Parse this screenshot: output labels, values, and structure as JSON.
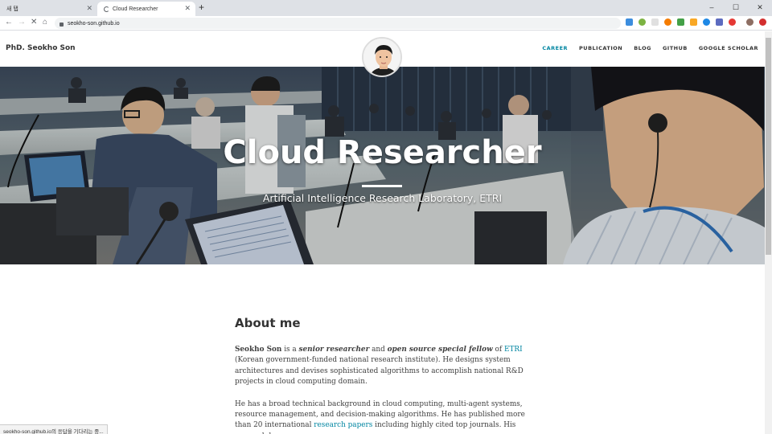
{
  "browser": {
    "tabs": [
      {
        "title": "새 탭",
        "active": false
      },
      {
        "title": "Cloud Researcher",
        "active": true
      }
    ],
    "new_tab": "+",
    "window_controls": [
      "–",
      "☐",
      "✕"
    ],
    "url": "seokho-son.github.io",
    "status_text": "seokho-son.github.io의 응답을 기다리는 중..."
  },
  "site": {
    "brand": "PhD. Seokho Son",
    "nav": [
      {
        "label": "CAREER",
        "current": true
      },
      {
        "label": "PUBLICATION",
        "current": false
      },
      {
        "label": "BLOG",
        "current": false
      },
      {
        "label": "GITHUB",
        "current": false
      },
      {
        "label": "GOOGLE SCHOLAR",
        "current": false
      }
    ],
    "accent_color": "#0085a1"
  },
  "hero": {
    "title": "Cloud Researcher",
    "subtitle": "Artificial Intelligence Research Laboratory, ETRI"
  },
  "about": {
    "heading": "About me",
    "p1": {
      "name": "Seokho Son",
      "t1": " is a ",
      "role1": "senior researcher",
      "t2": " and ",
      "role2": "open source special fellow",
      "t3": " of ",
      "link": "ETRI",
      "t4": " (Korean government-funded national research institute). He designs system architectures and devises sophisticated algorithms to accomplish national R&D projects in cloud computing domain."
    },
    "p2": {
      "t1": "He has a broad technical background in cloud computing, multi-agent systems, resource management, and decision-making algorithms. He has published more than 20 international ",
      "link": "research papers",
      "t2": " including highly cited top journals. His research has"
    }
  }
}
